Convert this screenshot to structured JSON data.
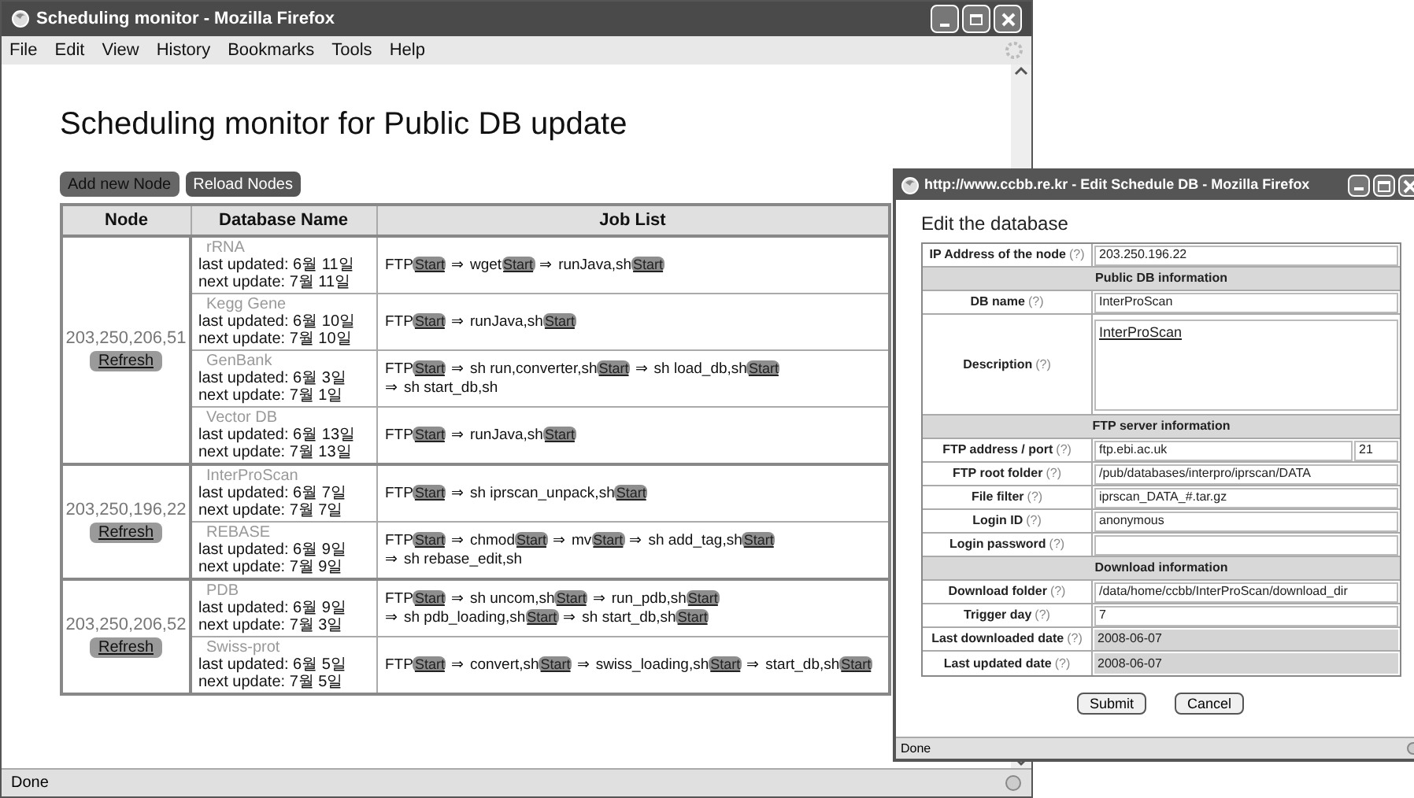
{
  "main_window": {
    "title": "Scheduling monitor - Mozilla Firefox",
    "menu": [
      "File",
      "Edit",
      "View",
      "History",
      "Bookmarks",
      "Tools",
      "Help"
    ],
    "status": "Done"
  },
  "page": {
    "heading": "Scheduling monitor for Public DB update",
    "buttons": [
      {
        "label": "Add new Node",
        "kind": "light"
      },
      {
        "label": "Reload Nodes",
        "kind": "dark"
      }
    ],
    "table": {
      "columns": [
        "Node",
        "Database Name",
        "Job List"
      ],
      "nodes": [
        {
          "ip": "203,250,206,51",
          "button": "Refresh",
          "databases": [
            {
              "name": "rRNA",
              "last": "last updated: 6월 11일",
              "next": "next update: 7월 11일",
              "jobs": [
                {
                  "cmd": "FTP",
                  "button": "Start"
                },
                {
                  "arrow": "⇒",
                  "cmd": "wget",
                  "button": "Start"
                },
                {
                  "arrow": "⇒",
                  "cmd": "runJava,sh",
                  "button": "Start"
                }
              ]
            },
            {
              "name": "Kegg Gene",
              "last": "last updated: 6월 10일",
              "next": "next update: 7월 10일",
              "jobs": [
                {
                  "cmd": "FTP",
                  "button": "Start"
                },
                {
                  "arrow": "⇒",
                  "cmd": "runJava,sh",
                  "button": "Start"
                }
              ]
            },
            {
              "name": "GenBank",
              "last": "last updated: 6월 3일",
              "next": "next update: 7월 1일",
              "jobs": [
                {
                  "cmd": "FTP",
                  "button": "Start"
                },
                {
                  "arrow": "⇒",
                  "cmd": "sh run,converter,sh",
                  "button": "Start"
                },
                {
                  "arrow": "⇒",
                  "cmd": "sh load_db,sh",
                  "button": "Start"
                },
                {
                  "arrow": "⇒",
                  "cmd": "sh start_db,sh"
                }
              ]
            },
            {
              "name": "Vector DB",
              "last": "last updated: 6월 13일",
              "next": "next update: 7월 13일",
              "jobs": [
                {
                  "cmd": "FTP",
                  "button": "Start"
                },
                {
                  "arrow": "⇒",
                  "cmd": "runJava,sh",
                  "button": "Start"
                }
              ]
            }
          ]
        },
        {
          "ip": "203,250,196,22",
          "button": "Refresh",
          "databases": [
            {
              "name": "InterProScan",
              "last": "last updated: 6월 7일",
              "next": "next update: 7월 7일",
              "jobs": [
                {
                  "cmd": "FTP",
                  "button": "Start"
                },
                {
                  "arrow": "⇒",
                  "cmd": "sh iprscan_unpack,sh",
                  "button": "Start"
                }
              ]
            },
            {
              "name": "REBASE",
              "last": "last updated: 6월 9일",
              "next": "next update: 7월 9일",
              "jobs": [
                {
                  "cmd": "FTP",
                  "button": "Start"
                },
                {
                  "arrow": "⇒",
                  "cmd": "chmod",
                  "button": "Start"
                },
                {
                  "arrow": "⇒",
                  "cmd": "mv",
                  "button": "Start"
                },
                {
                  "arrow": "⇒",
                  "cmd": "sh add_tag,sh",
                  "button": "Start"
                },
                {
                  "arrow": "⇒",
                  "cmd": "sh rebase_edit,sh"
                }
              ]
            }
          ]
        },
        {
          "ip": "203,250,206,52",
          "button": "Refresh",
          "databases": [
            {
              "name": "PDB",
              "last": "last updated: 6월 9일",
              "next": "next update: 7월 3일",
              "jobs": [
                {
                  "cmd": "FTP",
                  "button": "Start"
                },
                {
                  "arrow": "⇒",
                  "cmd": "sh uncom,sh",
                  "button": "Start"
                },
                {
                  "arrow": "⇒",
                  "cmd": "run_pdb,sh",
                  "button": "Start"
                },
                {
                  "arrow": "⇒",
                  "cmd": "sh pdb_loading,sh",
                  "button": "Start"
                },
                {
                  "arrow": "⇒",
                  "cmd": "sh start_db,sh",
                  "button": "Start"
                }
              ]
            },
            {
              "name": "Swiss-prot",
              "last": "last updated: 6월 5일",
              "next": "next update: 7월 5일",
              "jobs": [
                {
                  "cmd": "FTP",
                  "button": "Start"
                },
                {
                  "arrow": "⇒",
                  "cmd": "convert,sh",
                  "button": "Start"
                },
                {
                  "arrow": "⇒",
                  "cmd": "swiss_loading,sh",
                  "button": "Start"
                },
                {
                  "arrow": "⇒",
                  "cmd": "start_db,sh",
                  "button": "Start"
                }
              ]
            }
          ]
        }
      ]
    }
  },
  "popup": {
    "title": "http://www.ccbb.re.kr - Edit Schedule DB - Mozilla Firefox",
    "heading": "Edit the database",
    "rows": [
      {
        "kind": "field",
        "label": "IP Address of the node",
        "help": "(?)",
        "value": "203.250.196.22"
      },
      {
        "kind": "header",
        "label": "Public DB information"
      },
      {
        "kind": "field",
        "label": "DB name",
        "help": "(?)",
        "value": "InterProScan"
      },
      {
        "kind": "textarea",
        "label": "Description",
        "help": "(?)",
        "value": "InterProScan"
      },
      {
        "kind": "header",
        "label": "FTP server information"
      },
      {
        "kind": "dual",
        "label": "FTP address / port",
        "help": "(?)",
        "value": "ftp.ebi.ac.uk",
        "value2": "21"
      },
      {
        "kind": "field",
        "label": "FTP root folder",
        "help": "(?)",
        "value": "/pub/databases/interpro/iprscan/DATA"
      },
      {
        "kind": "field",
        "label": "File filter",
        "help": "(?)",
        "value": "iprscan_DATA_#.tar.gz"
      },
      {
        "kind": "field",
        "label": "Login ID",
        "help": "(?)",
        "value": "anonymous"
      },
      {
        "kind": "field",
        "label": "Login password",
        "help": "(?)"
      },
      {
        "kind": "header",
        "label": "Download information"
      },
      {
        "kind": "field",
        "label": "Download folder",
        "help": "(?)",
        "value": "/data/home/ccbb/InterProScan/download_dir"
      },
      {
        "kind": "field",
        "label": "Trigger day",
        "help": "(?)",
        "value": "7"
      },
      {
        "kind": "readonly",
        "label": "Last downloaded date",
        "help": "(?)",
        "value": "2008-06-07"
      },
      {
        "kind": "readonly",
        "label": "Last updated date",
        "help": "(?)",
        "value": "2008-06-07"
      }
    ],
    "buttons": [
      "Submit",
      "Cancel"
    ],
    "status": "Done"
  }
}
